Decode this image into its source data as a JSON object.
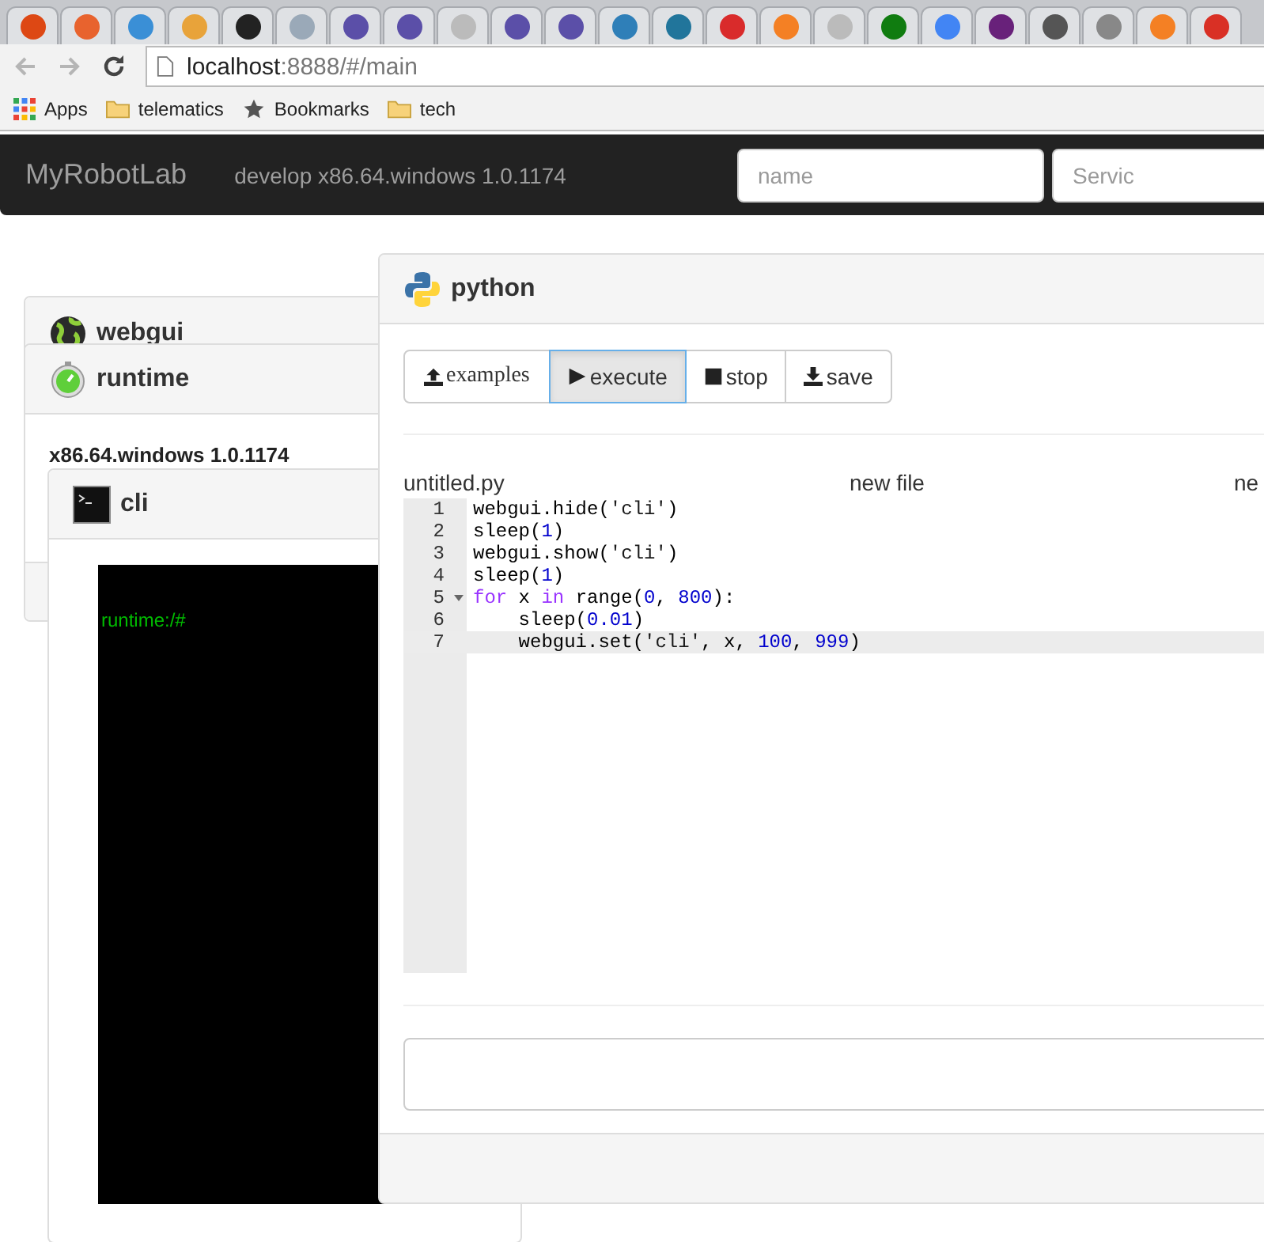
{
  "browser": {
    "tabs": [
      {
        "color": "#dd4814",
        "selected": false
      },
      {
        "color": "#e8632e",
        "selected": false
      },
      {
        "color": "#3a8fd6",
        "selected": false
      },
      {
        "color": "#e8a33a",
        "selected": false
      },
      {
        "color": "#222222",
        "selected": false
      },
      {
        "color": "#9aa9b8",
        "selected": false
      },
      {
        "color": "#5b4fa8",
        "selected": false
      },
      {
        "color": "#5b4fa8",
        "selected": false
      },
      {
        "color": "#bbbbbb",
        "selected": false
      },
      {
        "color": "#5b4fa8",
        "selected": false
      },
      {
        "color": "#5b4fa8",
        "selected": false
      },
      {
        "color": "#2f7fb8",
        "selected": false
      },
      {
        "color": "#21759b",
        "selected": false
      },
      {
        "color": "#d92b2b",
        "selected": false
      },
      {
        "color": "#f48024",
        "selected": false
      },
      {
        "color": "#bbbbbb",
        "selected": false
      },
      {
        "color": "#107c10",
        "selected": false
      },
      {
        "color": "#4285f4",
        "selected": false
      },
      {
        "color": "#68217a",
        "selected": false
      },
      {
        "color": "#555555",
        "selected": false
      },
      {
        "color": "#888888",
        "selected": false
      },
      {
        "color": "#f48024",
        "selected": false
      },
      {
        "color": "#d93025",
        "selected": false
      }
    ],
    "back_disabled": true,
    "forward_disabled": true,
    "url": {
      "host": "localhost",
      "path": ":8888/#/main"
    },
    "bookmarks": [
      {
        "kind": "apps",
        "label": "Apps"
      },
      {
        "kind": "folder",
        "label": "telematics"
      },
      {
        "kind": "star",
        "label": "Bookmarks"
      },
      {
        "kind": "folder",
        "label": "tech"
      }
    ]
  },
  "navbar": {
    "brand": "MyRobotLab",
    "version": "develop x86.64.windows 1.0.1174",
    "inputs": [
      {
        "placeholder": "name"
      },
      {
        "placeholder": "Servic"
      }
    ]
  },
  "panels": {
    "webgui": {
      "title": "webgui"
    },
    "runtime": {
      "title": "runtime",
      "platform": "x86.64.windows 1.0.1174"
    },
    "cli": {
      "title": "cli",
      "prompt": "runtime:/#"
    },
    "python": {
      "title": "python",
      "buttons": [
        {
          "kind": "upload",
          "label": "examples",
          "selected": false
        },
        {
          "kind": "play",
          "label": "execute",
          "selected": true
        },
        {
          "kind": "stop",
          "label": "stop",
          "selected": false
        },
        {
          "kind": "download",
          "label": "save",
          "selected": false
        }
      ],
      "files": [
        "untitled.py",
        "new file",
        "ne"
      ],
      "lines": [
        {
          "number": "1",
          "fold": false,
          "active": false,
          "tokens": [
            {
              "kind": "plain",
              "text": "webgui.hide("
            },
            {
              "kind": "string",
              "text": "'cli'"
            },
            {
              "kind": "plain",
              "text": ")"
            }
          ]
        },
        {
          "number": "2",
          "fold": false,
          "active": false,
          "tokens": [
            {
              "kind": "plain",
              "text": "sleep("
            },
            {
              "kind": "number",
              "text": "1"
            },
            {
              "kind": "plain",
              "text": ")"
            }
          ]
        },
        {
          "number": "3",
          "fold": false,
          "active": false,
          "tokens": [
            {
              "kind": "plain",
              "text": "webgui.show("
            },
            {
              "kind": "string",
              "text": "'cli'"
            },
            {
              "kind": "plain",
              "text": ")"
            }
          ]
        },
        {
          "number": "4",
          "fold": false,
          "active": false,
          "tokens": [
            {
              "kind": "plain",
              "text": "sleep("
            },
            {
              "kind": "number",
              "text": "1"
            },
            {
              "kind": "plain",
              "text": ")"
            }
          ]
        },
        {
          "number": "5",
          "fold": true,
          "active": false,
          "tokens": [
            {
              "kind": "keyword",
              "text": "for"
            },
            {
              "kind": "plain",
              "text": " x "
            },
            {
              "kind": "keyword",
              "text": "in"
            },
            {
              "kind": "plain",
              "text": " range("
            },
            {
              "kind": "number",
              "text": "0"
            },
            {
              "kind": "plain",
              "text": ", "
            },
            {
              "kind": "number",
              "text": "800"
            },
            {
              "kind": "plain",
              "text": "):"
            }
          ]
        },
        {
          "number": "6",
          "fold": false,
          "active": false,
          "tokens": [
            {
              "kind": "plain",
              "text": "    sleep("
            },
            {
              "kind": "number",
              "text": "0.01"
            },
            {
              "kind": "plain",
              "text": ")"
            }
          ]
        },
        {
          "number": "7",
          "fold": false,
          "active": true,
          "tokens": [
            {
              "kind": "plain",
              "text": "    webgui.set("
            },
            {
              "kind": "string",
              "text": "'cli'"
            },
            {
              "kind": "plain",
              "text": ", x, "
            },
            {
              "kind": "number",
              "text": "100"
            },
            {
              "kind": "plain",
              "text": ", "
            },
            {
              "kind": "number",
              "text": "999"
            },
            {
              "kind": "plain",
              "text": ")"
            }
          ]
        }
      ]
    }
  }
}
